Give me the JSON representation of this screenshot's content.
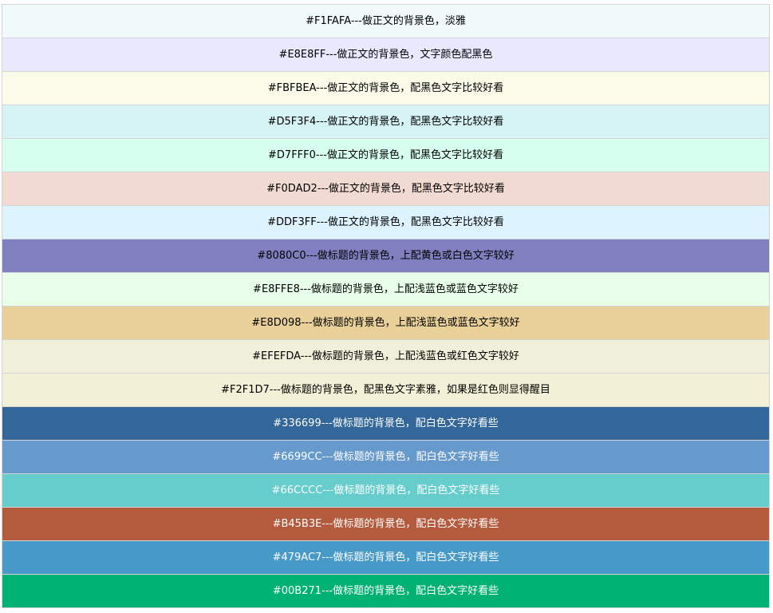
{
  "rows": [
    {
      "label": "#F1FAFA---做正文的背景色，淡雅",
      "bg": "#F1FAFA",
      "fg": "#000000"
    },
    {
      "label": "#E8E8FF---做正文的背景色，文字颜色配黑色",
      "bg": "#E8E8FF",
      "fg": "#000000"
    },
    {
      "label": "#FBFBEA---做正文的背景色，配黑色文字比较好看",
      "bg": "#FBFBEA",
      "fg": "#000000"
    },
    {
      "label": "#D5F3F4---做正文的背景色，配黑色文字比较好看",
      "bg": "#D5F3F4",
      "fg": "#000000"
    },
    {
      "label": "#D7FFF0---做正文的背景色，配黑色文字比较好看",
      "bg": "#D7FFF0",
      "fg": "#000000"
    },
    {
      "label": "#F0DAD2---做正文的背景色，配黑色文字比较好看",
      "bg": "#F0DAD2",
      "fg": "#000000"
    },
    {
      "label": "#DDF3FF---做正文的背景色，配黑色文字比较好看",
      "bg": "#DDF3FF",
      "fg": "#000000"
    },
    {
      "label": "#8080C0---做标题的背景色，上配黄色或白色文字较好",
      "bg": "#8080C0",
      "fg": "#000000"
    },
    {
      "label": "#E8FFE8---做标题的背景色，上配浅蓝色或蓝色文字较好",
      "bg": "#E8FFE8",
      "fg": "#000000"
    },
    {
      "label": "#E8D098---做标题的背景色，上配浅蓝色或蓝色文字较好",
      "bg": "#E8D098",
      "fg": "#000000"
    },
    {
      "label": "#EFEFDA---做标题的背景色，上配浅蓝色或红色文字较好",
      "bg": "#EFEFDA",
      "fg": "#000000"
    },
    {
      "label": "#F2F1D7---做标题的背景色，配黑色文字素雅，如果是红色则显得醒目",
      "bg": "#F2F1D7",
      "fg": "#000000"
    },
    {
      "label": "#336699---做标题的背景色，配白色文字好看些",
      "bg": "#336699",
      "fg": "#FFFFFF"
    },
    {
      "label": "#6699CC---做标题的背景色，配白色文字好看些",
      "bg": "#6699CC",
      "fg": "#FFFFFF"
    },
    {
      "label": "#66CCCC---做标题的背景色，配白色文字好看些",
      "bg": "#66CCCC",
      "fg": "#FFFFFF"
    },
    {
      "label": "#B45B3E---做标题的背景色，配白色文字好看些",
      "bg": "#B45B3E",
      "fg": "#FFFFFF"
    },
    {
      "label": "#479AC7---做标题的背景色，配白色文字好看些",
      "bg": "#479AC7",
      "fg": "#FFFFFF"
    },
    {
      "label": "#00B271---做标题的背景色，配白色文字好看些",
      "bg": "#00B271",
      "fg": "#FFFFFF"
    }
  ]
}
